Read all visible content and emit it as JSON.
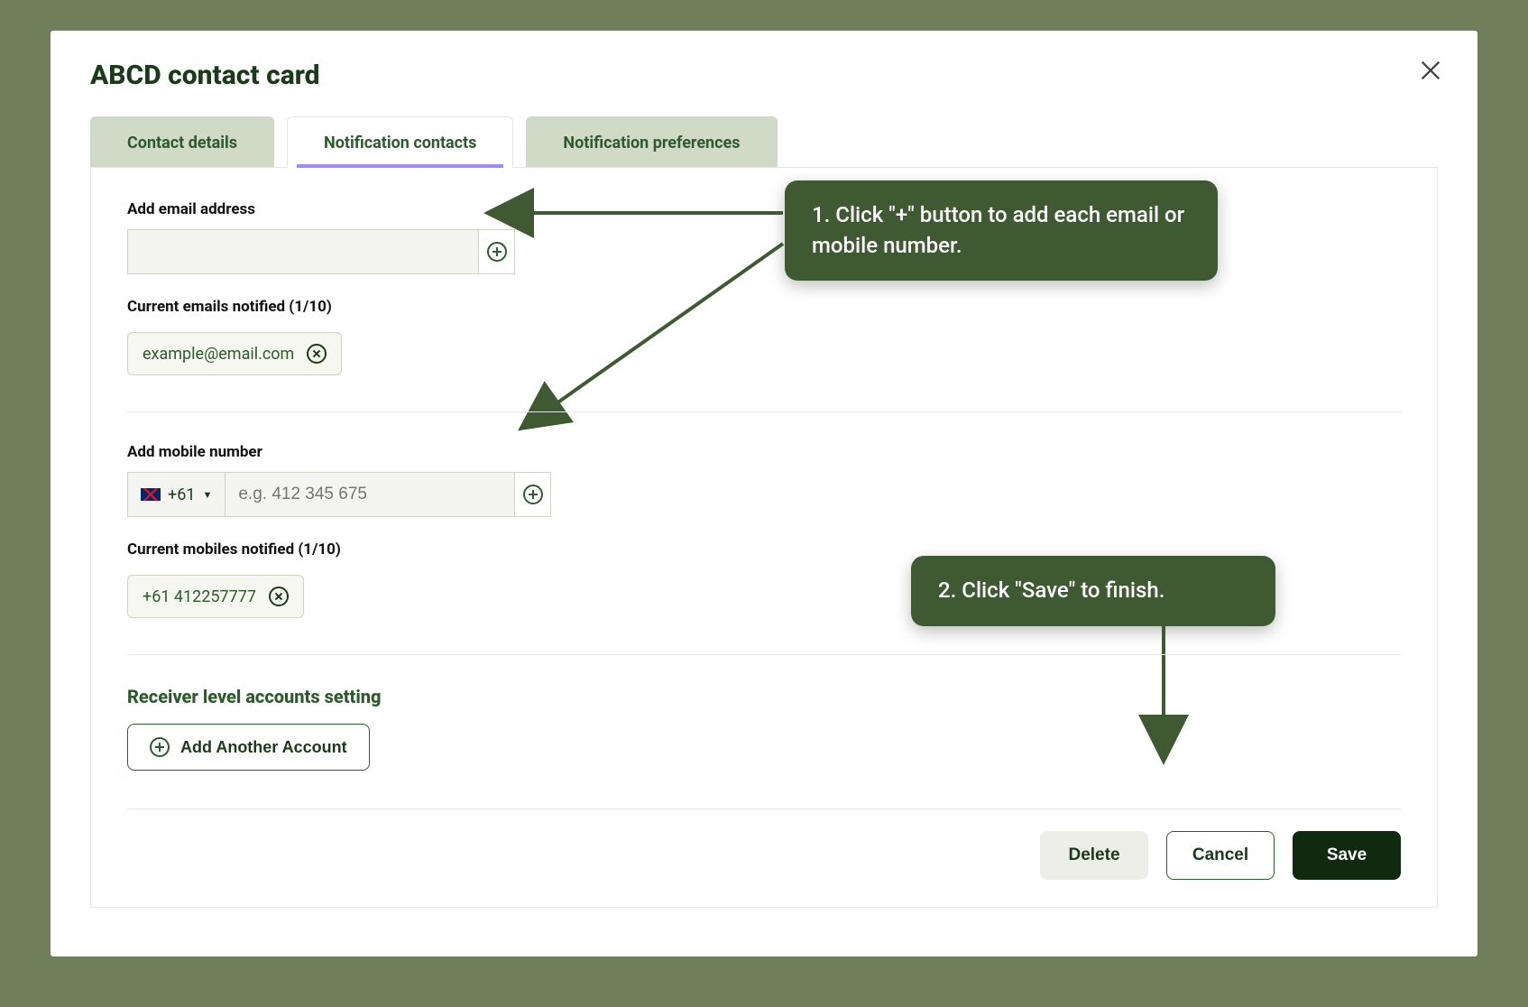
{
  "title": "ABCD contact card",
  "tabs": {
    "details": "Contact details",
    "contacts": "Notification contacts",
    "prefs": "Notification preferences"
  },
  "email": {
    "add_label": "Add email address",
    "value": "",
    "current_label": "Current emails notified (1/10)",
    "chips": [
      "example@email.com"
    ]
  },
  "mobile": {
    "add_label": "Add mobile number",
    "country_code": "+61",
    "placeholder": "e.g. 412 345 675",
    "value": "",
    "current_label": "Current mobiles notified (1/10)",
    "chips": [
      "+61 412257777"
    ]
  },
  "receiver": {
    "heading": "Receiver level accounts setting",
    "add_button": "Add Another Account"
  },
  "footer": {
    "delete": "Delete",
    "cancel": "Cancel",
    "save": "Save"
  },
  "callouts": {
    "one": "1. Click \"+\" button to add each email or mobile number.",
    "two": "2. Click \"Save\" to finish."
  }
}
